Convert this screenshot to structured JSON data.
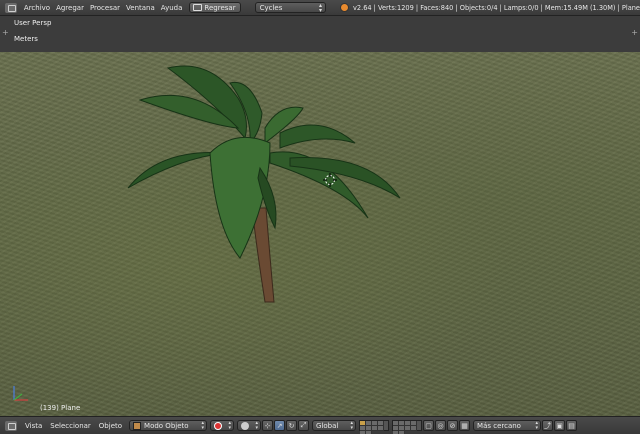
{
  "topbar": {
    "menus": [
      "Archivo",
      "Agregar",
      "Procesar",
      "Ventana",
      "Ayuda"
    ],
    "back_button": "Regresar",
    "render_engine": "Cycles",
    "stats": "v2.64 | Verts:1209 | Faces:840 | Objects:0/4 | Lamps:0/0 | Mem:15.49M (1.30M) | Plane"
  },
  "viewport": {
    "view_name": "User Persp",
    "units": "Meters",
    "object_info": "(139) Plane"
  },
  "bottombar": {
    "menus": [
      "Vista",
      "Seleccionar",
      "Objeto"
    ],
    "mode": "Modo Objeto",
    "orientation": "Global",
    "snap_target": "Más cercano"
  },
  "colors": {
    "ground": "#626a47",
    "leaf": "#2f5a2a",
    "trunk": "#6a4a33",
    "accent": "#e88a2e"
  }
}
